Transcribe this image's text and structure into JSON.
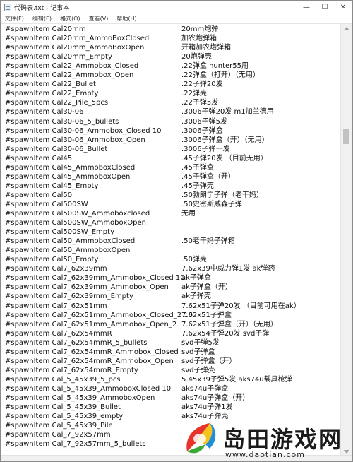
{
  "window": {
    "title": "代码表.txt - 记事本",
    "minimize_glyph": "—",
    "maximize_glyph": "☐",
    "close_glyph": "✕"
  },
  "menu": [
    "文件(F)",
    "编辑(E)",
    "格式(O)",
    "查看(V)",
    "帮助(H)"
  ],
  "lines": [
    {
      "cmd": "#spawnItem Cal20mm",
      "desc": "20mm炮弹"
    },
    {
      "cmd": "#spawnItem Cal20mm_AmmoBoxClosed",
      "desc": "加农炮弹箱"
    },
    {
      "cmd": "#spawnItem Cal20mm_AmmoBoxOpen",
      "desc": "开箱加农炮弹箱"
    },
    {
      "cmd": "#spawnItem Cal20mm_Empty",
      "desc": "20炮弹壳"
    },
    {
      "cmd": "#spawnItem Cal22_Ammobox_Closed",
      "desc": ".22弹盒 hunter55用"
    },
    {
      "cmd": "#spawnItem Cal22_Ammobox_Open",
      "desc": ".22弹盒（打开）（无用）"
    },
    {
      "cmd": "#spawnItem Cal22_Bullet",
      "desc": ".22子弹20发"
    },
    {
      "cmd": "#spawnItem Cal22_Empty",
      "desc": ".22弹壳"
    },
    {
      "cmd": "#spawnItem Cal22_Pile_5pcs",
      "desc": ".22子弹5发"
    },
    {
      "cmd": "#spawnItem Cal30-06",
      "desc": ".3006子弹20发 m1加兰德用"
    },
    {
      "cmd": "#spawnItem Cal30-06_5_bullets",
      "desc": ".3006子弹5发"
    },
    {
      "cmd": "#spawnItem Cal30-06_Ammobox_Closed 10",
      "desc": ".3006子弹盒"
    },
    {
      "cmd": "#spawnItem Cal30-06_Ammobox_Open",
      "desc": ".3006子弹盒（开）（无用）"
    },
    {
      "cmd": "#spawnItem Cal30-06_Bullet",
      "desc": ".3006子弹一发"
    },
    {
      "cmd": "#spawnItem Cal45",
      "desc": ".45子弹20发 （目前无用）"
    },
    {
      "cmd": "#spawnItem Cal45_AmmoboxClosed",
      "desc": ".45子弹盒"
    },
    {
      "cmd": "#spawnItem Cal45_AmmoboxOpen",
      "desc": ".45子弹盒（开）"
    },
    {
      "cmd": "#spawnItem Cal45_Empty",
      "desc": ".45子弹壳"
    },
    {
      "cmd": "#spawnItem Cal50",
      "desc": ".50勃朗宁子弹（老干妈）"
    },
    {
      "cmd": "#spawnItem Cal500SW",
      "desc": ".50史密斯威森子弹"
    },
    {
      "cmd": "#spawnItem Cal500SW_Ammoboxclosed",
      "desc": "无用"
    },
    {
      "cmd": "#spawnItem Cal500SW_AmmoboxOpen",
      "desc": ""
    },
    {
      "cmd": "#spawnItem Cal500SW_Empty",
      "desc": ""
    },
    {
      "cmd": "#spawnItem Cal50_AmmoboxClosed",
      "desc": ".50老干妈子弹箱"
    },
    {
      "cmd": "#spawnItem Cal50_AmmoboxOpen",
      "desc": ""
    },
    {
      "cmd": "#spawnItem Cal50_Empty",
      "desc": ".50弹壳"
    },
    {
      "cmd": "#spawnItem Cal7_62x39mm",
      "desc": "7.62x39中威力弹1发 ak弹药"
    },
    {
      "cmd": "#spawnItem Cal7_62x39mm_Ammobox_Closed 10",
      "desc": "ak子弹盒"
    },
    {
      "cmd": "#spawnItem Cal7_62x39mm_Ammobox_Open",
      "desc": "ak子弹盒（开）"
    },
    {
      "cmd": "#spawnItem Cal7_62x39mm_Empty",
      "desc": "ak子弹壳"
    },
    {
      "cmd": "#spawnItem Cal7_62x51mm",
      "desc": "7.62x51子弹20发 （目前可用在ak）"
    },
    {
      "cmd": "#spawnItem Cal7_62x51mm_Ammobox_Closed_2 10",
      "desc": "7.62x51子弹盒"
    },
    {
      "cmd": "#spawnItem Cal7_62x51mm_Ammobox_Open_2",
      "desc": "7.62x51子弹盒（开）（无用）"
    },
    {
      "cmd": "#spawnItem Cal7_62x54mmR",
      "desc": "7.62x54子弹20发 svd子弹"
    },
    {
      "cmd": "#spawnItem Cal7_62x54mmR_5_bullets",
      "desc": "svd子弹5发"
    },
    {
      "cmd": "#spawnItem Cal7_62x54mmR_Ammobox_Closed",
      "desc": "svd子弹盒"
    },
    {
      "cmd": "#spawnItem Cal7_62x54mmR_Ammobox_Open",
      "desc": "svd子弹盒（开）"
    },
    {
      "cmd": "#spawnItem Cal7_62x54mmR_Empty",
      "desc": "svd子弹壳"
    },
    {
      "cmd": "#spawnItem Cal_5_45x39_5_pcs",
      "desc": "5.45x39子弹5发 aks74u载具枪弹"
    },
    {
      "cmd": "#spawnItem Cal_5_45x39_AmmoboxClosed 10",
      "desc": "aks74u子弹盒"
    },
    {
      "cmd": "#spawnItem Cal_5_45x39_AmmoboxOpen",
      "desc": "aks74u子弹盒（开）"
    },
    {
      "cmd": "#spawnItem Cal_5_45x39_Bullet",
      "desc": "aks74u子弹1发"
    },
    {
      "cmd": "#spawnItem Cal_5_45x39_empty",
      "desc": "aks74u子弹壳"
    },
    {
      "cmd": "#spawnItem Cal_5_45x39_Pile",
      "desc": ""
    },
    {
      "cmd": "#spawnItem Cal_7_92x57mm",
      "desc": ""
    },
    {
      "cmd": "#spawnItem Cal_7_92x57mm_5_bullets",
      "desc": ""
    }
  ],
  "watermark": {
    "name": "岛田游戏网",
    "url": "www.daotian.com"
  },
  "colors": {
    "logo_red": "#e8332a",
    "logo_yellow": "#f7c21a",
    "logo_green": "#3aa935",
    "logo_blue": "#1f8fd6"
  }
}
